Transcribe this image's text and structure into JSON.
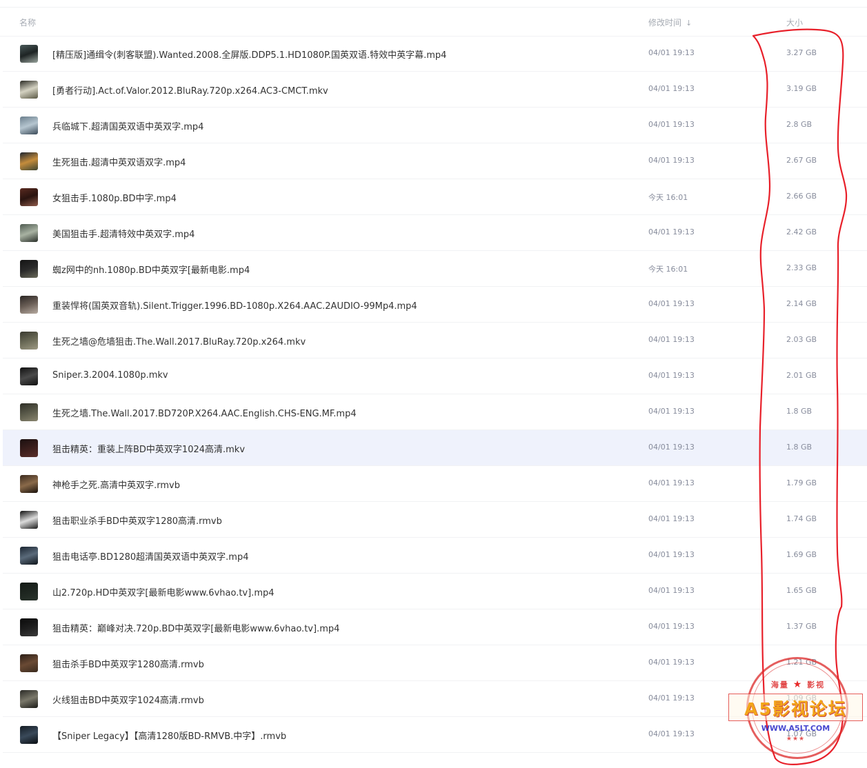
{
  "header": {
    "name_label": "名称",
    "time_label": "修改时间",
    "sort_indicator": "↓",
    "size_label": "大小"
  },
  "files": [
    {
      "name": "[精压版]通缉令(刺客联盟).Wanted.2008.全屏版.DDP5.1.HD1080P.国英双语.特效中英字幕.mp4",
      "time": "04/01 19:13",
      "size": "3.27 GB",
      "thumb": [
        "#4a5a5a",
        "#1e2424",
        "#9aa59e"
      ]
    },
    {
      "name": "[勇者行动].Act.of.Valor.2012.BluRay.720p.x264.AC3-CMCT.mkv",
      "time": "04/01 19:13",
      "size": "3.19 GB",
      "thumb": [
        "#2a2a24",
        "#d4d2c2",
        "#5a5844"
      ]
    },
    {
      "name": "兵临城下.超清国英双语中英双字.mp4",
      "time": "04/01 19:13",
      "size": "2.8 GB",
      "thumb": [
        "#6a7e8c",
        "#b6c6d0",
        "#3a4a58"
      ]
    },
    {
      "name": "生死狙击.超清中英双语双字.mp4",
      "time": "04/01 19:13",
      "size": "2.67 GB",
      "thumb": [
        "#1e2630",
        "#c48c3c",
        "#3e4632"
      ]
    },
    {
      "name": "女狙击手.1080p.BD中字.mp4",
      "time": "今天 16:01",
      "size": "2.66 GB",
      "thumb": [
        "#5a2a20",
        "#2a1410",
        "#8e5a4a"
      ]
    },
    {
      "name": "美国狙击手.超清特效中英双字.mp4",
      "time": "04/01 19:13",
      "size": "2.42 GB",
      "thumb": [
        "#4e5a50",
        "#a8b2a2",
        "#2a302a"
      ]
    },
    {
      "name": "蜘z网中的nh.1080p.BD中英双字[最新电影.mp4",
      "time": "今天 16:01",
      "size": "2.33 GB",
      "thumb": [
        "#141414",
        "#2a2a2a",
        "#6a6a5a"
      ]
    },
    {
      "name": "重装悍将(国英双音轨).Silent.Trigger.1996.BD-1080p.X264.AAC.2AUDIO-99Mp4.mp4",
      "time": "04/01 19:13",
      "size": "2.14 GB",
      "thumb": [
        "#2a2624",
        "#6a5e56",
        "#b8aca2"
      ]
    },
    {
      "name": "生死之墙@危墙狙击.The.Wall.2017.BluRay.720p.x264.mkv",
      "time": "04/01 19:13",
      "size": "2.03 GB",
      "thumb": [
        "#3a3a30",
        "#6a6a56",
        "#9e9a84"
      ]
    },
    {
      "name": "Sniper.3.2004.1080p.mkv",
      "time": "04/01 19:13",
      "size": "2.01 GB",
      "thumb": [
        "#101010",
        "#4a4a4a",
        "#101010"
      ]
    },
    {
      "name": "生死之墙.The.Wall.2017.BD720P.X264.AAC.English.CHS-ENG.MF.mp4",
      "time": "04/01 19:13",
      "size": "1.8 GB",
      "thumb": [
        "#2e2e26",
        "#5a5a4a",
        "#8a8670"
      ]
    },
    {
      "name": "狙击精英：重装上阵BD中英双字1024高清.mkv",
      "time": "04/01 19:13",
      "size": "1.8 GB",
      "thumb": [
        "#1a1010",
        "#3a1e1c",
        "#5a2e2a"
      ],
      "selected": true
    },
    {
      "name": "神枪手之死.高清中英双字.rmvb",
      "time": "04/01 19:13",
      "size": "1.79 GB",
      "thumb": [
        "#3a2a1e",
        "#8a6a4a",
        "#1a120c"
      ]
    },
    {
      "name": "狙击职业杀手BD中英双字1280高清.rmvb",
      "time": "04/01 19:13",
      "size": "1.74 GB",
      "thumb": [
        "#0e0e0e",
        "#dcdcdc",
        "#1a1a1a"
      ]
    },
    {
      "name": "狙击电话亭.BD1280超清国英双语中英双字.mp4",
      "time": "04/01 19:13",
      "size": "1.69 GB",
      "thumb": [
        "#1a2430",
        "#5a6a7a",
        "#0e141a"
      ]
    },
    {
      "name": "山2.720p.HD中英双字[最新电影www.6vhao.tv].mp4",
      "time": "04/01 19:13",
      "size": "1.65 GB",
      "thumb": [
        "#141a16",
        "#1e2620",
        "#2a342c"
      ]
    },
    {
      "name": "狙击精英：巅峰对决.720p.BD中英双字[最新电影www.6vhao.tv].mp4",
      "time": "04/01 19:13",
      "size": "1.37 GB",
      "thumb": [
        "#0a0a0a",
        "#1e1e1e",
        "#3a3a3a"
      ]
    },
    {
      "name": "狙击杀手BD中英双字1280高清.rmvb",
      "time": "04/01 19:13",
      "size": "1.21 GB",
      "thumb": [
        "#2a1e16",
        "#6a4a34",
        "#3a2a1e"
      ]
    },
    {
      "name": "火线狙击BD中英双字1024高清.rmvb",
      "time": "04/01 19:13",
      "size": "1.09 GB",
      "thumb": [
        "#2a2a26",
        "#7a786a",
        "#1a1a16"
      ]
    },
    {
      "name": "【Sniper Legacy】【高清1280版BD-RMVB.中字】.rmvb",
      "time": "04/01 19:13",
      "size": "1.07 GB",
      "thumb": [
        "#141c24",
        "#3a4a5a",
        "#0a0e12"
      ]
    }
  ],
  "annotation_color": "#e8202a",
  "watermark": {
    "top_text_left": "海量",
    "top_text_right": "影视",
    "title": "A5影视论坛",
    "url": "WWW.A5LT.COM",
    "stars": "★★★"
  }
}
